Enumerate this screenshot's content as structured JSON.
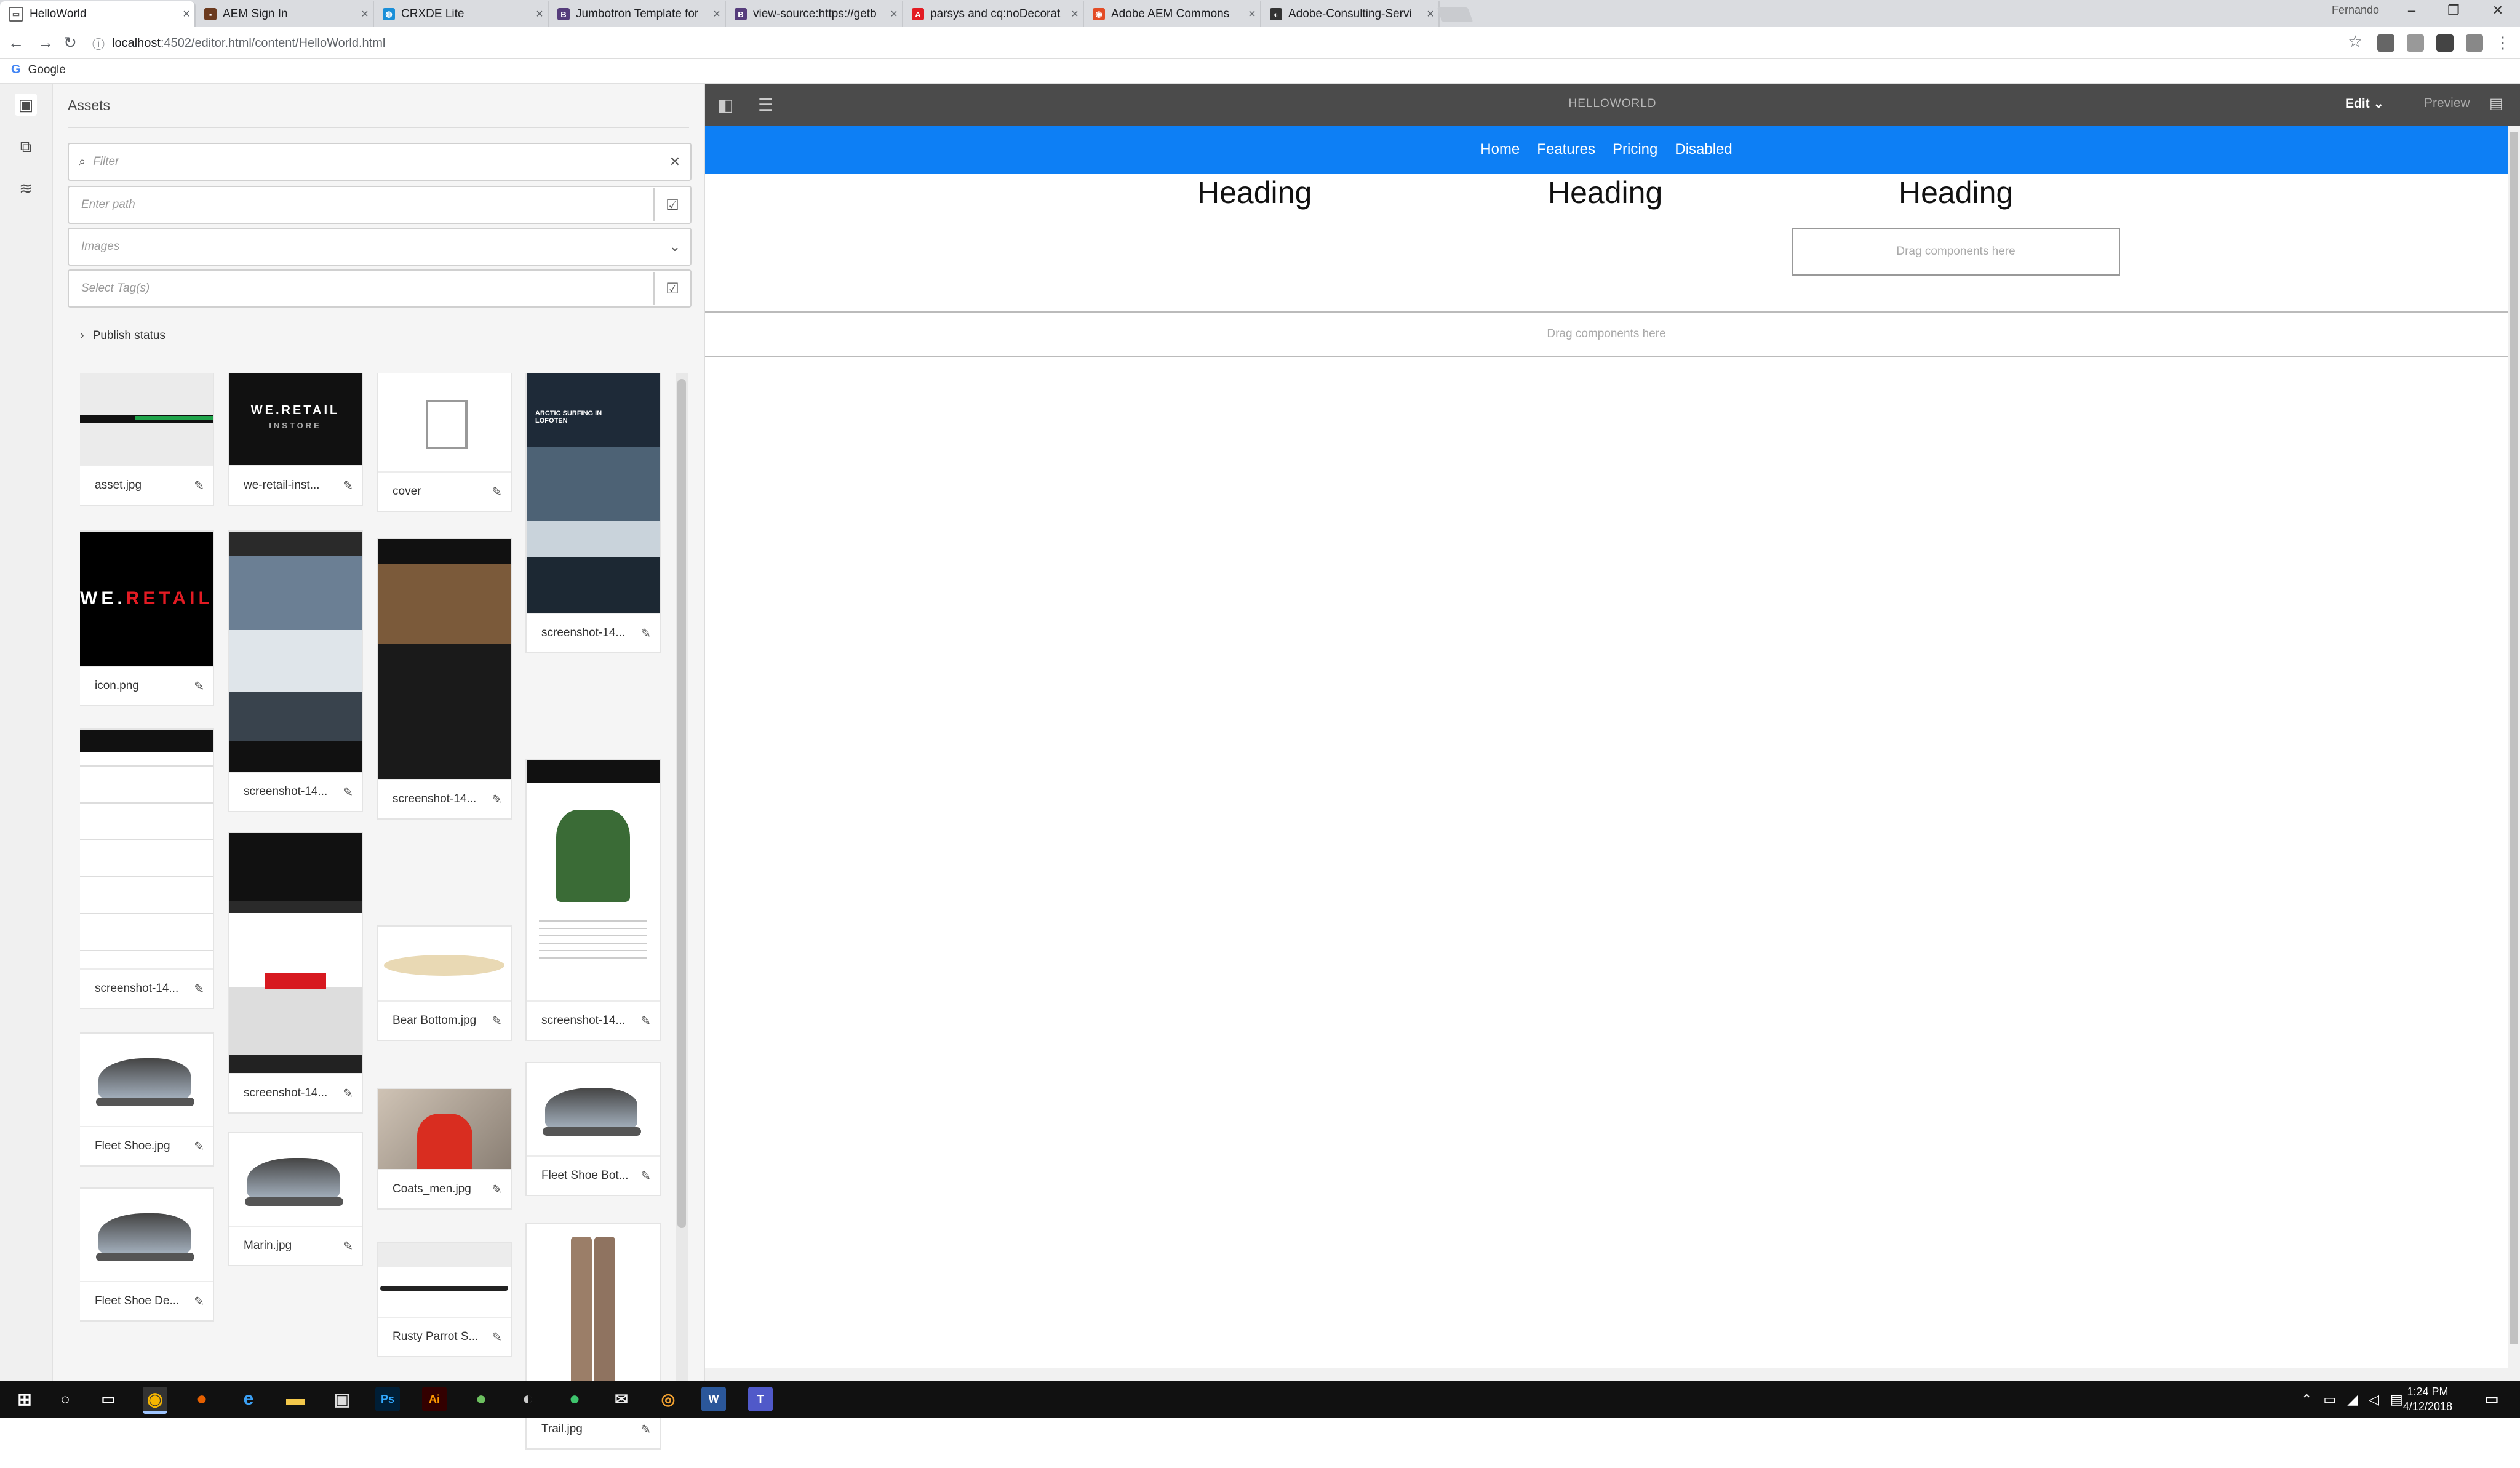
{
  "browser": {
    "tabs": [
      {
        "title": "HelloWorld",
        "color": "#ffffff",
        "glyph": "▭"
      },
      {
        "title": "AEM Sign In",
        "color": "#6b3a1e",
        "glyph": "▪"
      },
      {
        "title": "CRXDE Lite",
        "color": "#1a8fd8",
        "glyph": "◍"
      },
      {
        "title": "Jumbotron Template for",
        "color": "#563d7c",
        "glyph": "B"
      },
      {
        "title": "view-source:https://getb",
        "color": "#563d7c",
        "glyph": "B"
      },
      {
        "title": "parsys and cq:noDecorat",
        "color": "#e31b23",
        "glyph": "A"
      },
      {
        "title": "Adobe AEM Commons",
        "color": "#e34c26",
        "glyph": "◉"
      },
      {
        "title": "Adobe-Consulting-Servi",
        "color": "#333333",
        "glyph": "◐"
      }
    ],
    "profile": "Fernando",
    "url_host": "localhost",
    "url_path": ":4502/editor.html/content/HelloWorld.html",
    "bookmark": "Google"
  },
  "sidepanel": {
    "title": "Assets",
    "filter_placeholder": "Filter",
    "path_placeholder": "Enter path",
    "type_value": "Images",
    "tags_placeholder": "Select Tag(s)",
    "publish_status": "Publish status",
    "assets": [
      {
        "name": "asset.jpg",
        "kind": "green"
      },
      {
        "name": "icon.png",
        "kind": "weretail"
      },
      {
        "name": "screenshot-14...",
        "kind": "list"
      },
      {
        "name": "Fleet Shoe.jpg",
        "kind": "shoe"
      },
      {
        "name": "Fleet Shoe De...",
        "kind": "shoe"
      },
      {
        "name": "we-retail-inst...",
        "kind": "instore"
      },
      {
        "name": "screenshot-14...",
        "kind": "mountain"
      },
      {
        "name": "screenshot-14...",
        "kind": "more"
      },
      {
        "name": "Marin.jpg",
        "kind": "shoe"
      },
      {
        "name": "cover",
        "kind": "doc"
      },
      {
        "name": "screenshot-14...",
        "kind": "catalog"
      },
      {
        "name": "Bear Bottom.jpg",
        "kind": "board"
      },
      {
        "name": "Coats_men.jpg",
        "kind": "coat"
      },
      {
        "name": "Rusty Parrot S...",
        "kind": "board2"
      },
      {
        "name": "screenshot-14...",
        "kind": "surf"
      },
      {
        "name": "screenshot-14...",
        "kind": "jacket"
      },
      {
        "name": "Fleet Shoe Bot...",
        "kind": "shoe"
      },
      {
        "name": "Trail.jpg",
        "kind": "pants"
      }
    ]
  },
  "editor": {
    "page_title": "HELLOWORLD",
    "mode": "Edit",
    "preview": "Preview",
    "nav": [
      "Home",
      "Features",
      "Pricing",
      "Disabled"
    ],
    "headings": [
      "Heading",
      "Heading",
      "Heading"
    ],
    "drop_hint": "Drag components here"
  },
  "taskbar": {
    "time": "1:24 PM",
    "date": "4/12/2018"
  }
}
